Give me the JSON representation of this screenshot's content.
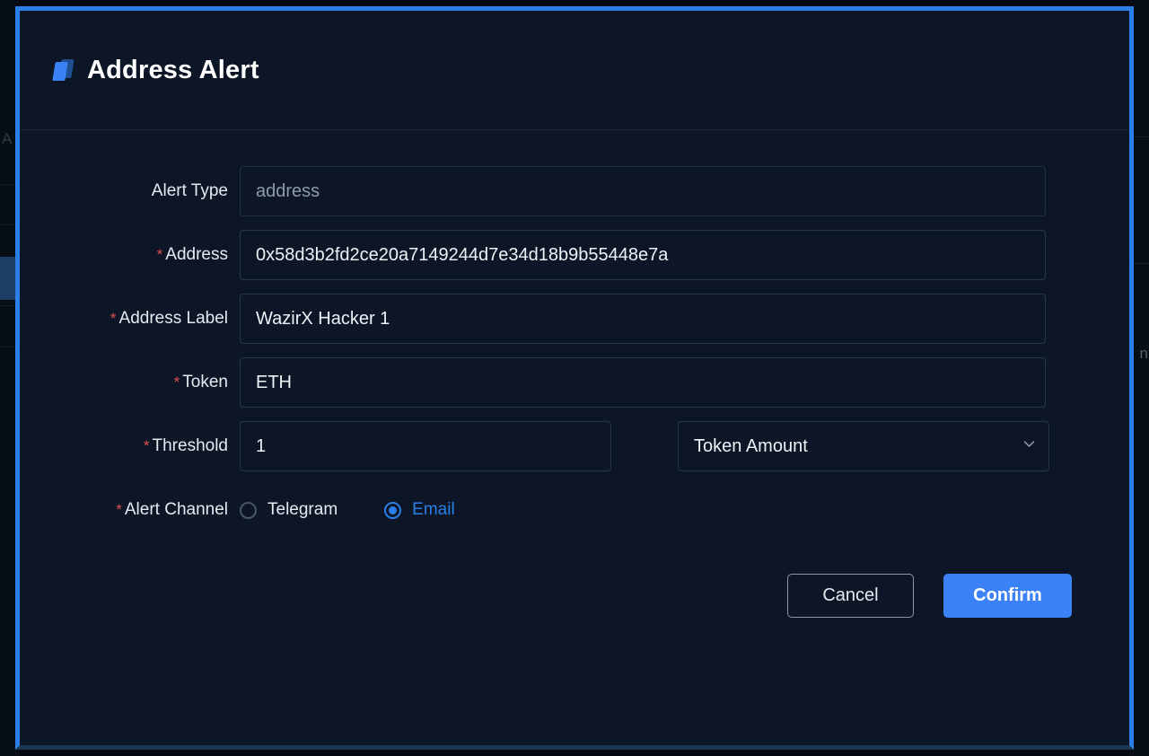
{
  "background": {
    "left_letter": "A",
    "right_text": "n"
  },
  "modal": {
    "title": "Address Alert",
    "icon": "layers-icon",
    "accent_color": "#2b7fe8",
    "surface_color": "#0c1626",
    "required_marker": "*",
    "fields": [
      {
        "label": "Alert Type",
        "required": false,
        "value": "address",
        "disabled": true,
        "name": "alert-type"
      },
      {
        "label": "Address",
        "required": true,
        "value": "0x58d3b2fd2ce20a7149244d7e34d18b9b55448e7a",
        "disabled": false,
        "name": "address"
      },
      {
        "label": "Address Label",
        "required": true,
        "value": "WazirX Hacker 1",
        "disabled": false,
        "name": "address-label"
      },
      {
        "label": "Token",
        "required": true,
        "value": "ETH",
        "disabled": false,
        "name": "token"
      }
    ],
    "threshold": {
      "label": "Threshold",
      "required": true,
      "value": "1",
      "unit_selected": "Token Amount",
      "unit_icon": "chevron-down-icon"
    },
    "alert_channel": {
      "label": "Alert Channel",
      "required": true,
      "options": [
        {
          "label": "Telegram",
          "selected": false
        },
        {
          "label": "Email",
          "selected": true
        }
      ]
    },
    "footer": {
      "cancel_label": "Cancel",
      "confirm_label": "Confirm"
    }
  }
}
